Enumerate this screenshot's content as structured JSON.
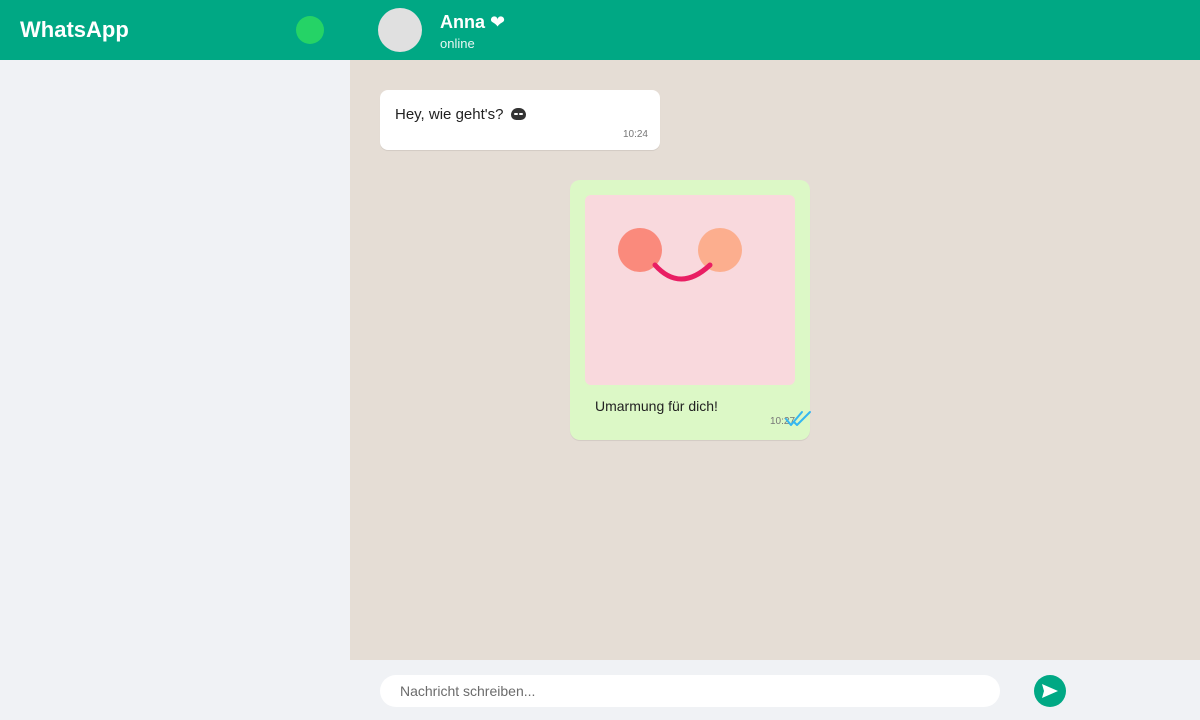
{
  "sidebar": {
    "app_title": "WhatsApp",
    "status_indicator_color": "#25d366"
  },
  "chat_header": {
    "contact_name": "Anna ❤",
    "contact_status": "online"
  },
  "messages": [
    {
      "direction": "incoming",
      "text": "Hey, wie geht's?",
      "emoji_icon": "smiling-face-icon",
      "time": "10:24"
    },
    {
      "direction": "outgoing",
      "attachment": "sticker",
      "sticker_icon": "hug-face-sticker",
      "caption": "Umarmung für dich!",
      "time": "10:27",
      "status_icon": "double-check-icon"
    }
  ],
  "composer": {
    "placeholder": "Nachricht schreiben...",
    "value": "",
    "send_icon": "send-icon"
  },
  "colors": {
    "brand": "#00a884",
    "chat_background": "#e5ddd5",
    "outgoing_bubble": "#dcf8c6",
    "incoming_bubble": "#ffffff",
    "read_ticks": "#34b7f1"
  }
}
